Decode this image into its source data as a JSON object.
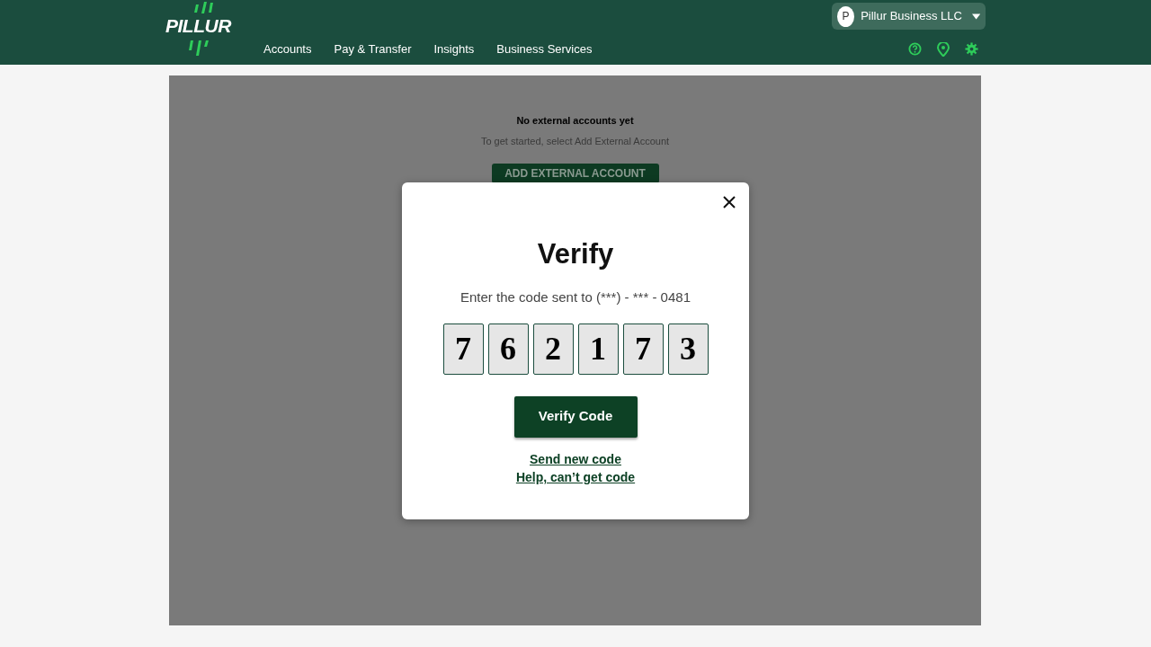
{
  "header": {
    "logo": "PILLUR",
    "nav": [
      {
        "label": "Accounts"
      },
      {
        "label": "Pay & Transfer"
      },
      {
        "label": "Insights"
      },
      {
        "label": "Business Services"
      }
    ],
    "account": {
      "initial": "P",
      "name": "Pillur Business LLC"
    }
  },
  "empty_state": {
    "title": "No external accounts yet",
    "subtitle": "To get started, select Add External Account",
    "button": "ADD EXTERNAL ACCOUNT"
  },
  "modal": {
    "title": "Verify",
    "message": "Enter the code sent to (***) - *** - 0481",
    "code": [
      "7",
      "6",
      "2",
      "1",
      "7",
      "3"
    ],
    "button": "Verify Code",
    "links": [
      "Send new code",
      "Help, can’t get code"
    ]
  }
}
